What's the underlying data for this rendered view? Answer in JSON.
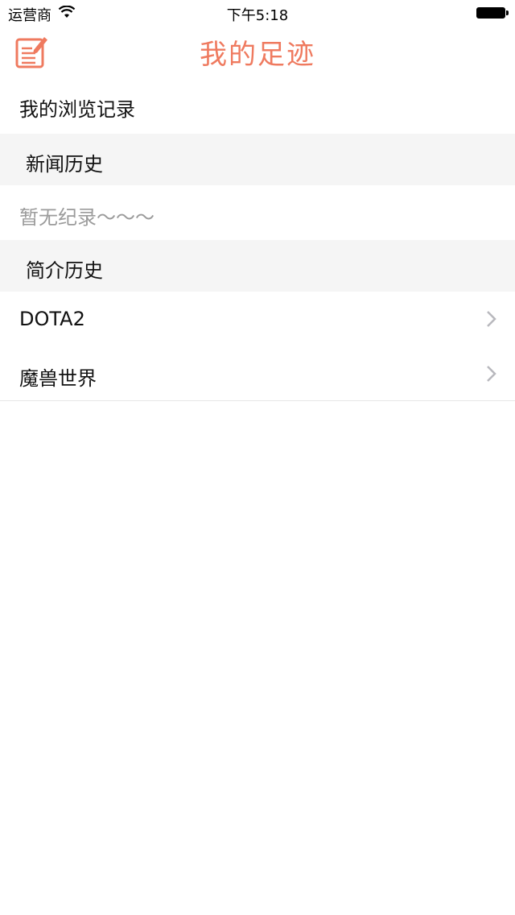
{
  "status_bar": {
    "carrier": "运营商",
    "time": "下午5:18"
  },
  "nav": {
    "title": "我的足迹",
    "accent_color": "#ef7a5f",
    "left_icon": "edit-note-icon"
  },
  "header_row": {
    "label": "我的浏览记录"
  },
  "sections": [
    {
      "title": "新闻历史",
      "empty_text": "暂无纪录～～～",
      "items": []
    },
    {
      "title": "简介历史",
      "items": [
        {
          "label": "DOTA2",
          "icon": "chevron-right-icon"
        },
        {
          "label": "魔兽世界",
          "icon": "chevron-right-icon"
        }
      ]
    }
  ]
}
